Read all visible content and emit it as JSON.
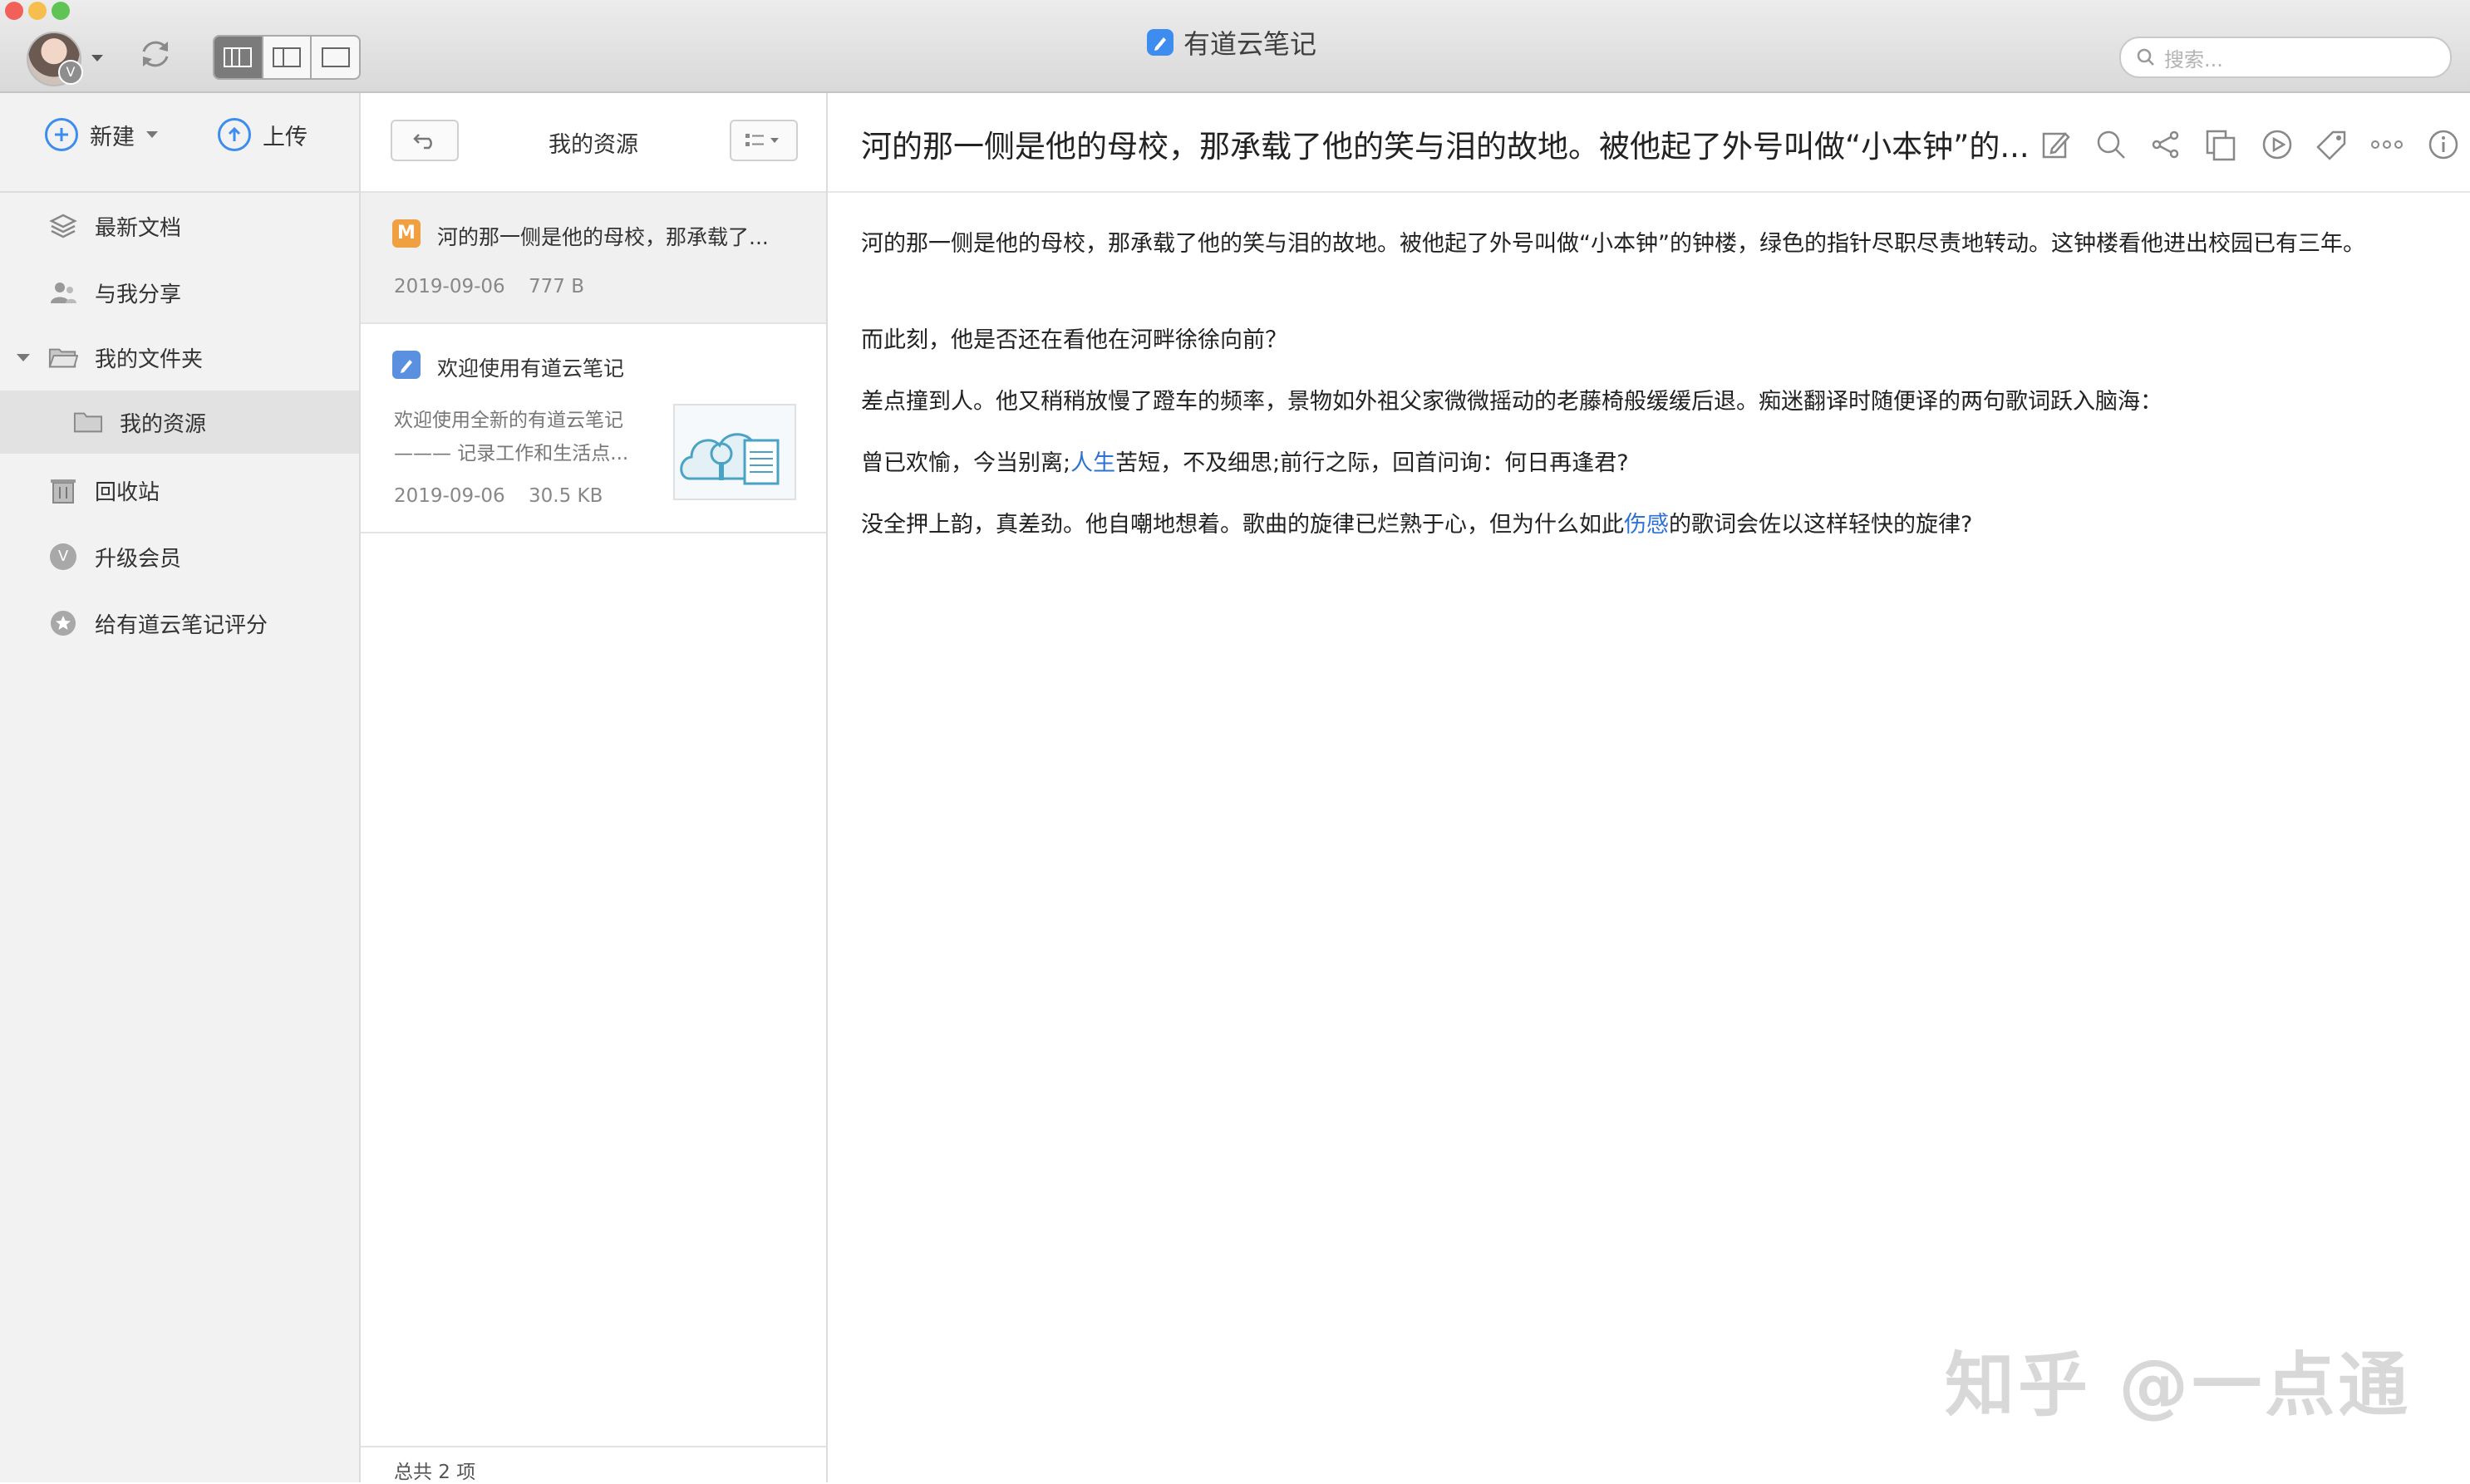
{
  "window": {
    "title": "有道云笔记",
    "search_placeholder": "搜索...",
    "avatar_badge": "V"
  },
  "sidebar": {
    "new_label": "新建",
    "upload_label": "上传",
    "items": [
      {
        "label": "最新文档",
        "icon": "layers-icon"
      },
      {
        "label": "与我分享",
        "icon": "shared-users-icon"
      },
      {
        "label": "我的文件夹",
        "icon": "folder-open-icon"
      },
      {
        "label": "我的资源",
        "icon": "folder-icon"
      },
      {
        "label": "回收站",
        "icon": "trash-icon"
      },
      {
        "label": "升级会员",
        "icon": "vip-icon",
        "badge": "V"
      },
      {
        "label": "给有道云笔记评分",
        "icon": "star-icon"
      }
    ]
  },
  "note_list": {
    "title": "我的资源",
    "notes": [
      {
        "badge": "M",
        "title": "河的那一侧是他的母校，那承载了...",
        "date": "2019-09-06",
        "size": "777 B"
      },
      {
        "title": "欢迎使用有道云笔记",
        "snippet_1": "欢迎使用全新的有道云笔记",
        "snippet_2": "——— 记录工作和生活点...",
        "date": "2019-09-06",
        "size": "30.5 KB"
      }
    ],
    "footer": "总共 2 项"
  },
  "editor": {
    "title": "河的那一侧是他的母校，那承载了他的笑与泪的故地。被他起了外号叫做“小本钟”的...",
    "toolbar": [
      "edit-icon",
      "search-icon",
      "share-icon",
      "copy-icon",
      "play-icon",
      "tag-icon",
      "more-icon",
      "info-icon"
    ],
    "paragraphs": {
      "p1": "河的那一侧是他的母校，那承载了他的笑与泪的故地。被他起了外号叫做“小本钟”的钟楼，绿色的指针尽职尽责地转动。这钟楼看他进出校园已有三年。",
      "p2": "而此刻，他是否还在看他在河畔徐徐向前？",
      "p3": "差点撞到人。他又稍稍放慢了蹬车的频率，景物如外祖父家微微摇动的老藤椅般缓缓后退。痴迷翻译时随便译的两句歌词跃入脑海：",
      "p4_a": "曾已欢愉，今当别离;",
      "p4_link": "人生",
      "p4_b": "苦短，不及细思;前行之际，回首问询：何日再逢君?",
      "p5_a": "没全押上韵，真差劲。他自嘲地想着。歌曲的旋律已烂熟于心，但为什么如此",
      "p5_link": "伤感",
      "p5_b": "的歌词会佐以这样轻快的旋律?"
    },
    "link_color": "#2f72d6"
  },
  "watermark": "知乎 @一点通",
  "colors": {
    "accent": "#3d8cf0",
    "markdown_badge": "#f0a040",
    "sidebar_bg": "#f2f2f2",
    "selected_bg": "#e2e2e2"
  }
}
